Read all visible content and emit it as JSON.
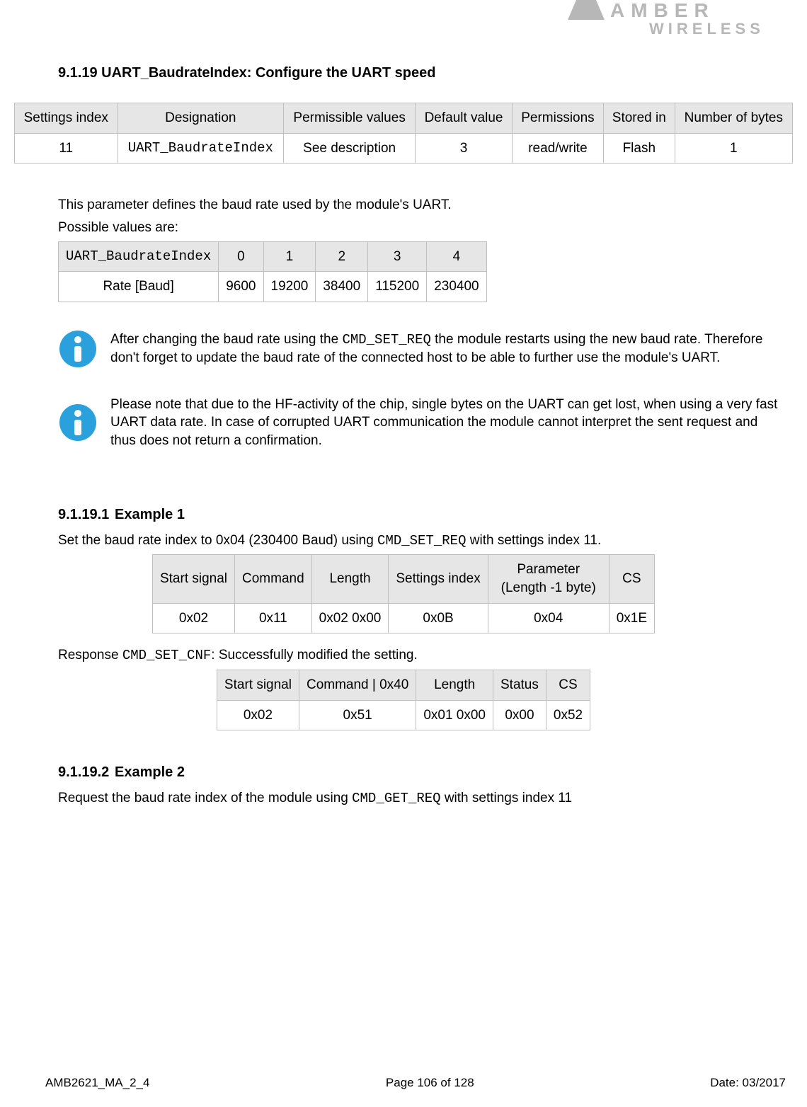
{
  "logo": {
    "line1": "AMBER",
    "line2": "WIRELESS"
  },
  "heading": "9.1.19 UART_BaudrateIndex: Configure the UART speed",
  "mainTable": {
    "headers": [
      "Settings index",
      "Designation",
      "Permissible values",
      "Default value",
      "Permissions",
      "Stored in",
      "Number of bytes"
    ],
    "row": [
      "11",
      "UART_BaudrateIndex",
      "See description",
      "3",
      "read/write",
      "Flash",
      "1"
    ]
  },
  "para1": "This parameter defines the baud rate used by the module's UART.",
  "para2": "Possible values are:",
  "valuesTable": {
    "headerLabel": "UART_BaudrateIndex",
    "cols": [
      "0",
      "1",
      "2",
      "3",
      "4"
    ],
    "rowLabel": "Rate [Baud]",
    "row": [
      "9600",
      "19200",
      "38400",
      "115200",
      "230400"
    ]
  },
  "note1": {
    "pre": "After changing the baud rate using the ",
    "code": "CMD_SET_REQ",
    "post": " the module restarts using the new baud rate. Therefore don't forget to update the baud rate of the connected host to be able to further use the module's UART."
  },
  "note2": "Please note that due to the HF-activity of the chip, single bytes on the UART can get lost, when using a very fast UART data rate. In case of corrupted UART communication the module cannot interpret the sent request and thus does not return a confirmation.",
  "example1": {
    "num": "9.1.19.1",
    "title": "Example 1",
    "intro_pre": "Set the baud rate index to 0x04 (230400 Baud) using  ",
    "intro_code": "CMD_SET_REQ",
    "intro_post": " with settings index 11.",
    "req": {
      "headers": [
        "Start signal",
        "Command",
        "Length",
        "Settings index",
        "Parameter (Length -1 byte)",
        "CS"
      ],
      "row": [
        "0x02",
        "0x11",
        "0x02 0x00",
        "0x0B",
        "0x04",
        "0x1E"
      ]
    },
    "resp_pre": "Response ",
    "resp_code": "CMD_SET_CNF",
    "resp_post": ": Successfully modified the setting.",
    "resp": {
      "headers": [
        "Start signal",
        "Command | 0x40",
        "Length",
        "Status",
        "CS"
      ],
      "row": [
        "0x02",
        "0x51",
        "0x01 0x00",
        "0x00",
        "0x52"
      ]
    }
  },
  "example2": {
    "num": "9.1.19.2",
    "title": "Example 2",
    "intro_pre": "Request the baud rate index of the module using  ",
    "intro_code": "CMD_GET_REQ",
    "intro_post": " with settings index 11"
  },
  "footer": {
    "doc": "AMB2621_MA_2_4",
    "page": "Page 106 of 128",
    "date": "Date: 03/2017"
  }
}
